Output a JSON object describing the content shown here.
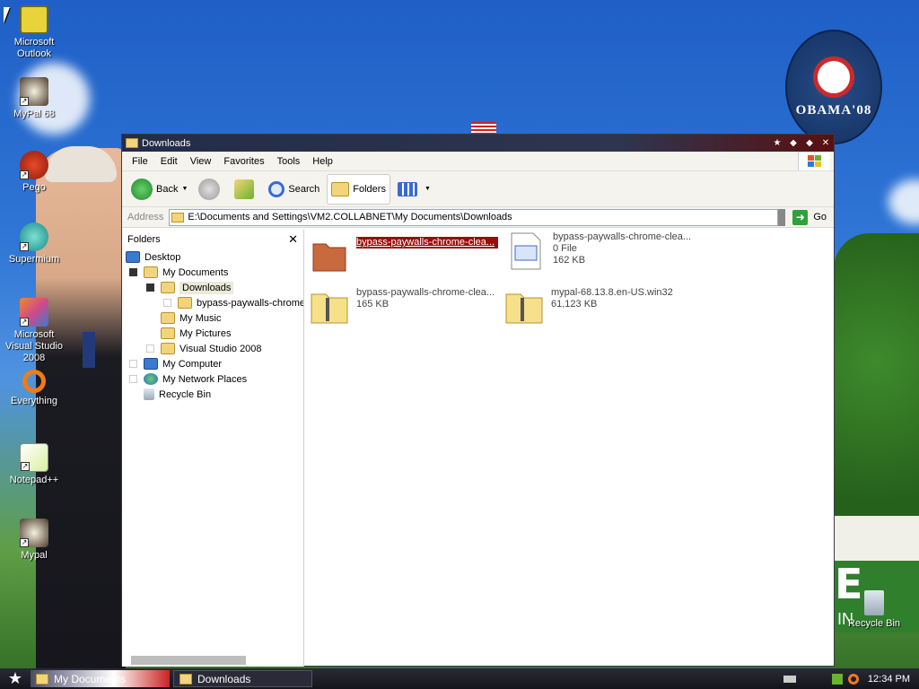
{
  "desktop": {
    "icons": [
      {
        "label": "Microsoft Outlook",
        "icon": "outlook-icon"
      },
      {
        "label": "MyPal 68",
        "icon": "mypal-icon"
      },
      {
        "label": "Pego",
        "icon": "pego-icon"
      },
      {
        "label": "Supermium",
        "icon": "supermium-icon"
      },
      {
        "label": "Microsoft Visual Studio 2008",
        "icon": "visual-studio-icon"
      },
      {
        "label": "Everything",
        "icon": "everything-icon"
      },
      {
        "label": "Notepad++",
        "icon": "notepadpp-icon"
      },
      {
        "label": "Mypal",
        "icon": "mypal-icon"
      },
      {
        "label": "Recycle Bin",
        "icon": "recycle-bin-icon"
      }
    ],
    "wallpaper": {
      "badge_text": "OBAMA'08"
    }
  },
  "window": {
    "title": "Downloads",
    "menu": [
      "File",
      "Edit",
      "View",
      "Favorites",
      "Tools",
      "Help"
    ],
    "toolbar": {
      "back": "Back",
      "search": "Search",
      "folders": "Folders"
    },
    "address": {
      "label": "Address",
      "value": "E:\\Documents and Settings\\VM2.COLLABNET\\My Documents\\Downloads",
      "go": "Go"
    },
    "folders_pane": {
      "title": "Folders",
      "tree": [
        {
          "label": "Desktop",
          "level": 0
        },
        {
          "label": "My Documents",
          "level": 1
        },
        {
          "label": "Downloads",
          "level": 2,
          "selected": true
        },
        {
          "label": "bypass-paywalls-chrome-",
          "level": 3
        },
        {
          "label": "My Music",
          "level": 2
        },
        {
          "label": "My Pictures",
          "level": 2
        },
        {
          "label": "Visual Studio 2008",
          "level": 2
        },
        {
          "label": "My Computer",
          "level": 1
        },
        {
          "label": "My Network Places",
          "level": 1
        },
        {
          "label": "Recycle Bin",
          "level": 1
        }
      ]
    },
    "files": [
      {
        "name": "bypass-paywalls-chrome-clea...",
        "type": "folder",
        "selected": true
      },
      {
        "name": "bypass-paywalls-chrome-clea...",
        "line2": "0 File",
        "line3": "162 KB",
        "type": "file"
      },
      {
        "name": "bypass-paywalls-chrome-clea...",
        "line2": "165 KB",
        "type": "zip"
      },
      {
        "name": "mypal-68.13.8.en-US.win32",
        "line2": "61,123 KB",
        "type": "zip"
      }
    ]
  },
  "taskbar": {
    "tasks": [
      "My Documents",
      "Downloads"
    ],
    "clock": "12:34 PM"
  }
}
